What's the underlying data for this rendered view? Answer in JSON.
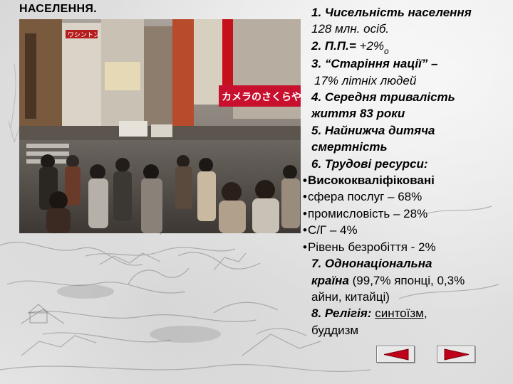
{
  "slide": {
    "title": "НАСЕЛЕННЯ.",
    "photo_alt": "",
    "points": [
      {
        "num": "1.",
        "label": "Чисельність населення"
      },
      {
        "value": "128 млн. осіб."
      },
      {
        "num": "2.",
        "label": "П.П.=",
        "value": "+2%",
        "sub": "о"
      },
      {
        "num": "3.",
        "label": "“Старіння нації” –"
      },
      {
        "value": "17% літніх людей"
      },
      {
        "num": "4.",
        "label": "Середня тривалість"
      },
      {
        "label2": "життя 83 роки"
      },
      {
        "num": "5.",
        "label": "Найнижча дитяча"
      },
      {
        "label2": "смертність"
      },
      {
        "num": "6.",
        "label": "Трудові ресурси:"
      }
    ],
    "bullets": [
      "Висококваліфіковані",
      "сфера послуг – 68%",
      "промисловість – 28%",
      "С/Г – 4%",
      "Рівень безробіття - 2%"
    ],
    "point7": {
      "num": "7.",
      "label_line1": "Однонаціональна",
      "label_line2": "країна",
      "detail_line2": "(99,7% японці, 0,3%",
      "detail_line3": "айни, китайці)"
    },
    "point8": {
      "num": "8.",
      "label": "Релігія:",
      "value_underlined": "синтоїзм,",
      "value_line2": "буддизм"
    }
  },
  "sign_texts": {
    "sign1": "カメラのさくらや",
    "sign2": "ワシントン"
  },
  "nav": {
    "prev_icon": "arrow-left-icon",
    "next_icon": "arrow-right-icon",
    "arrow_color": "#c0001a"
  }
}
